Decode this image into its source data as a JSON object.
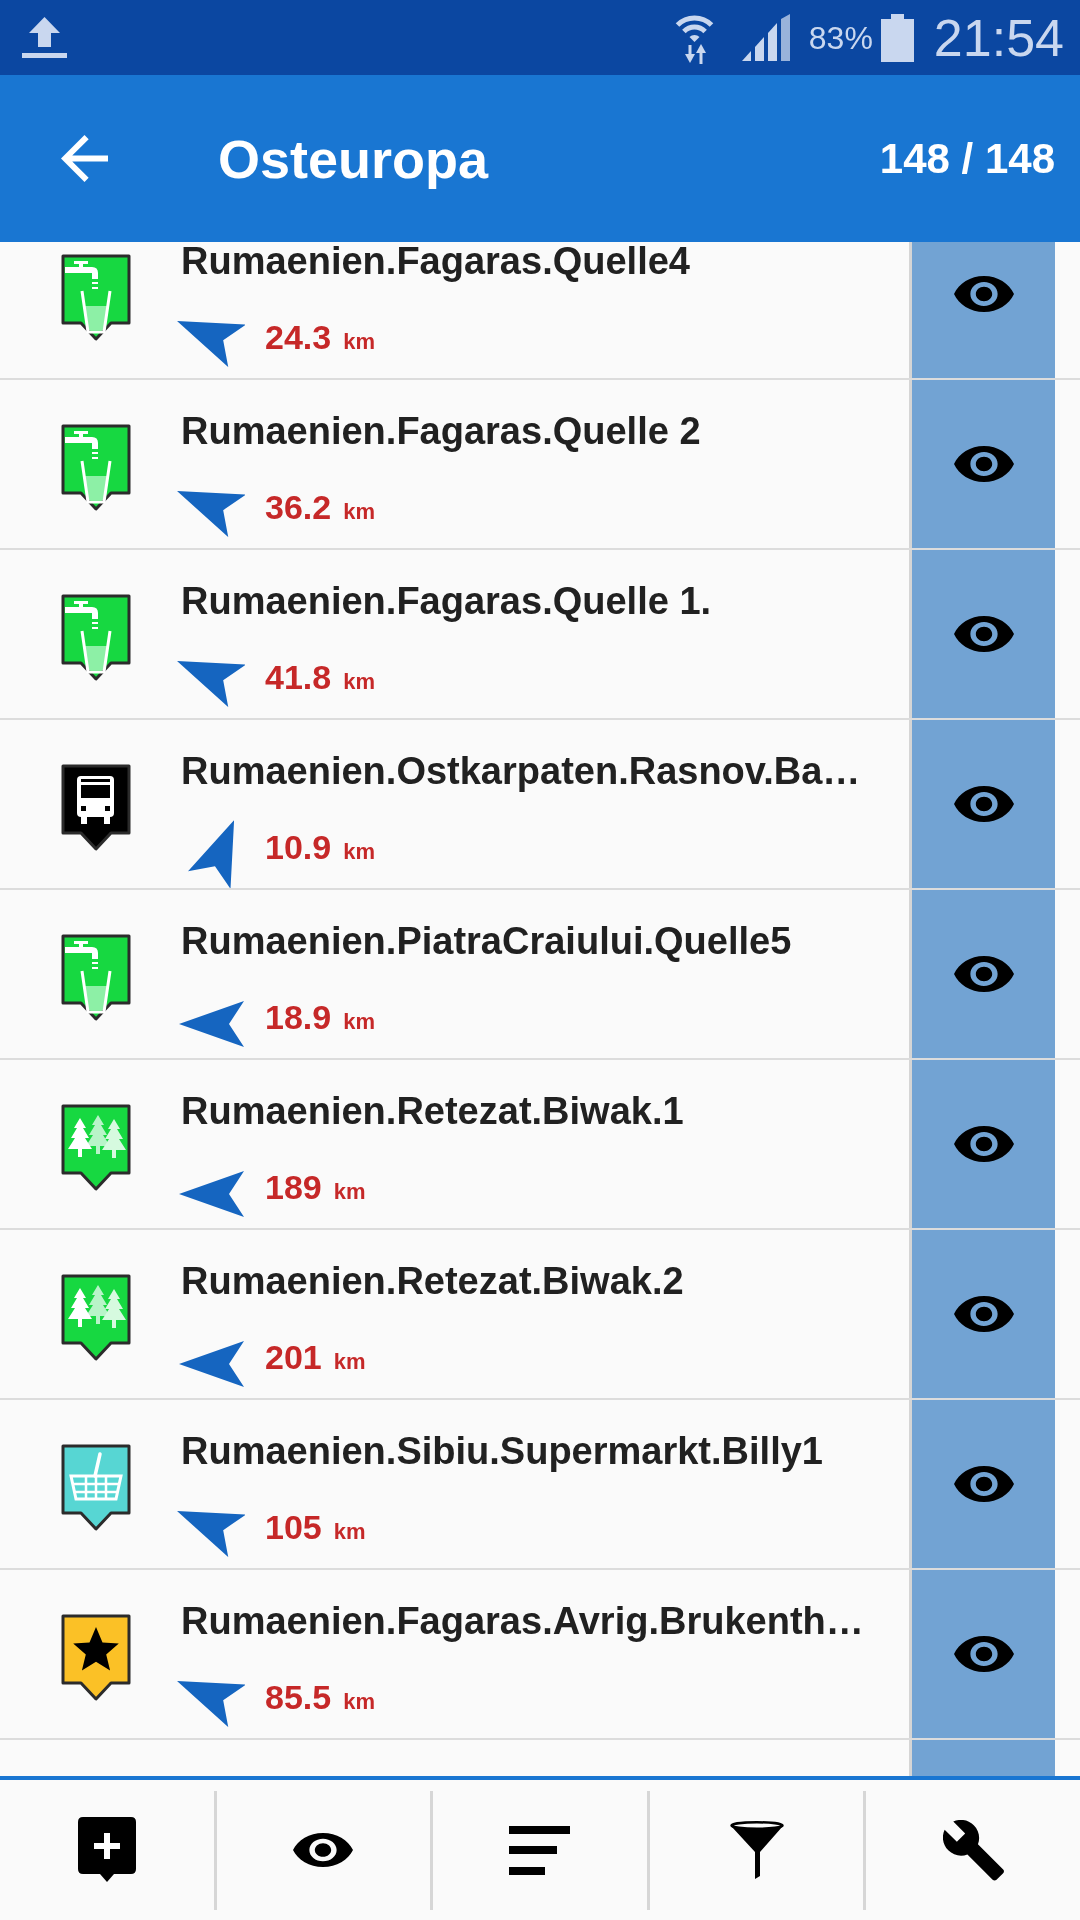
{
  "status_bar": {
    "battery": "83%",
    "time": "21:54"
  },
  "app_bar": {
    "title": "Osteuropa",
    "count": "148 / 148"
  },
  "rows": [
    {
      "kind": "water",
      "name": "Rumaenien.Fagaras.Quelle4",
      "arrow": {
        "kind": "wnw"
      },
      "distance": "24.3",
      "unit": "km",
      "visible": true
    },
    {
      "kind": "water",
      "name": "Rumaenien.Fagaras.Quelle 2",
      "arrow": {
        "kind": "wnw"
      },
      "distance": "36.2",
      "unit": "km",
      "visible": true
    },
    {
      "kind": "water",
      "name": "Rumaenien.Fagaras.Quelle 1.",
      "arrow": {
        "kind": "wnw"
      },
      "distance": "41.8",
      "unit": "km",
      "visible": true
    },
    {
      "kind": "bus",
      "name": "Rumaenien.Ostkarpaten.Rasnov.Ba…",
      "arrow": {
        "kind": "nne"
      },
      "distance": "10.9",
      "unit": "km",
      "visible": true
    },
    {
      "kind": "water",
      "name": "Rumaenien.PiatraCraiului.Quelle5",
      "arrow": {
        "kind": "w"
      },
      "distance": "18.9",
      "unit": "km",
      "visible": true
    },
    {
      "kind": "forest",
      "name": "Rumaenien.Retezat.Biwak.1",
      "arrow": {
        "kind": "w"
      },
      "distance": "189",
      "unit": "km",
      "visible": true
    },
    {
      "kind": "forest",
      "name": "Rumaenien.Retezat.Biwak.2",
      "arrow": {
        "kind": "w"
      },
      "distance": "201",
      "unit": "km",
      "visible": true
    },
    {
      "kind": "shop",
      "name": "Rumaenien.Sibiu.Supermarkt.Billy1",
      "arrow": {
        "kind": "wnw"
      },
      "distance": "105",
      "unit": "km",
      "visible": true
    },
    {
      "kind": "star",
      "name": "Rumaenien.Fagaras.Avrig.Brukenth…",
      "arrow": {
        "kind": "wnw"
      },
      "distance": "85.5",
      "unit": "km",
      "visible": true
    }
  ]
}
